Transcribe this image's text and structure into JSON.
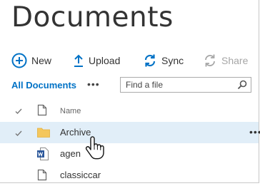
{
  "page": {
    "title": "Documents"
  },
  "commands": [
    {
      "label": "New",
      "icon": "plus-circle-icon"
    },
    {
      "label": "Upload",
      "icon": "upload-arrow-icon"
    },
    {
      "label": "Sync",
      "icon": "sync-icon"
    },
    {
      "label": "Share",
      "icon": "share-icon",
      "disabled": true
    }
  ],
  "view": {
    "label": "All Documents",
    "more": "•••"
  },
  "search": {
    "placeholder": "Find a file"
  },
  "list": {
    "header": {
      "name": "Name"
    },
    "rows": [
      {
        "name": "Archive",
        "type": "folder",
        "selected": true,
        "more": "•••"
      },
      {
        "name": "agen",
        "type": "word"
      },
      {
        "name": "classiccar",
        "type": "file"
      }
    ]
  },
  "colors": {
    "accent": "#0072c6",
    "selected_row": "#e1eef8",
    "folder": "#f4c75d",
    "word": "#2b579a",
    "disabled": "#a6a6a6"
  }
}
